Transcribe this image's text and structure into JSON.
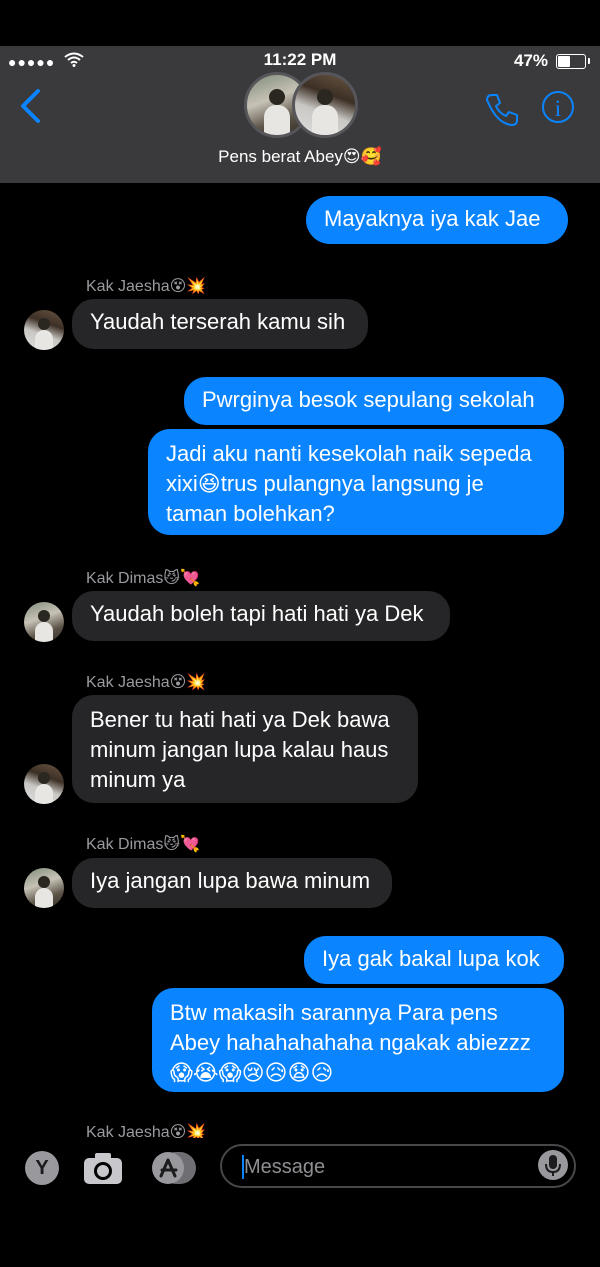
{
  "status": {
    "signal": "●●●●●",
    "time": "11:22 PM",
    "battery": "47%"
  },
  "header": {
    "chat_name": "Pens berat Abey😍🥰"
  },
  "messages": [
    {
      "type": "out",
      "text": "Mayaknya iya kak Jae"
    },
    {
      "type": "sender",
      "text": "Kak Jaesha😵💥"
    },
    {
      "type": "in",
      "text": "Yaudah terserah kamu sih"
    },
    {
      "type": "out",
      "text": "Pwrginya besok sepulang sekolah"
    },
    {
      "type": "out",
      "text": "Jadi aku nanti kesekolah naik sepeda xixi😆trus pulangnya langsung je taman bolehkan?"
    },
    {
      "type": "sender",
      "text": "Kak Dimas😼💘"
    },
    {
      "type": "in",
      "text": "Yaudah boleh tapi hati hati ya Dek"
    },
    {
      "type": "sender",
      "text": "Kak Jaesha😵💥"
    },
    {
      "type": "in",
      "text": "Bener tu hati hati ya Dek bawa minum jangan lupa kalau haus minum ya"
    },
    {
      "type": "sender",
      "text": "Kak Dimas😼💘"
    },
    {
      "type": "in",
      "text": "Iya jangan lupa bawa minum"
    },
    {
      "type": "out",
      "text": "Iya gak bakal lupa kok"
    },
    {
      "type": "out",
      "text": "Btw makasih sarannya Para pens Abey hahahahahaha ngakak abiezzz😱😭😱😢😥😧😥"
    },
    {
      "type": "sender",
      "text": "Kak Jaesha😵💥"
    }
  ],
  "input": {
    "placeholder": "Message",
    "apps_letter": "Y"
  }
}
